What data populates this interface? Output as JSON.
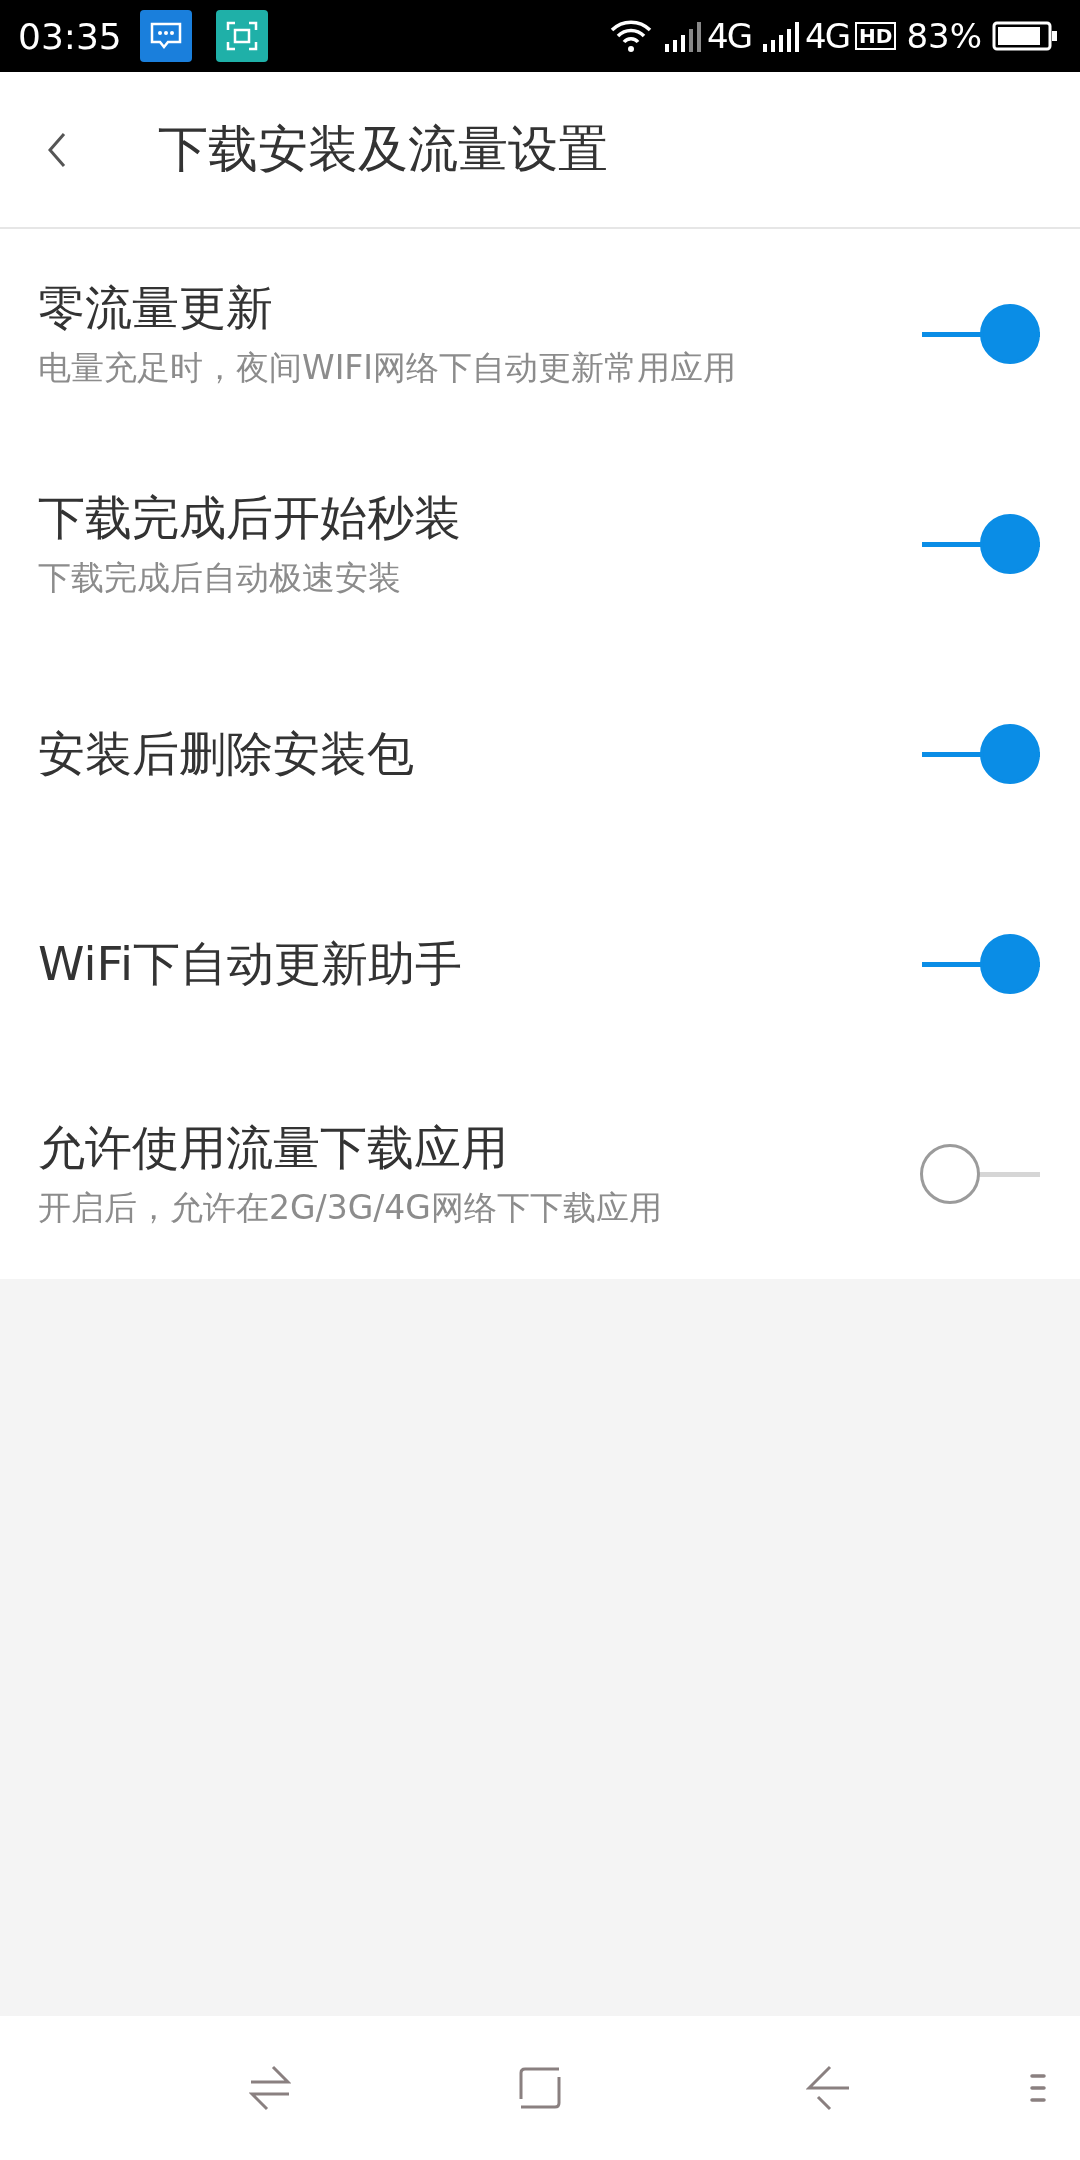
{
  "status_bar": {
    "time": "03:35",
    "network_1": "4G",
    "network_2": "4G",
    "hd": "HD",
    "battery": "83%"
  },
  "header": {
    "title": "下载安装及流量设置"
  },
  "settings": [
    {
      "title": "零流量更新",
      "subtitle": "电量充足时，夜间WIFI网络下自动更新常用应用",
      "on": true
    },
    {
      "title": "下载完成后开始秒装",
      "subtitle": "下载完成后自动极速安装",
      "on": true
    },
    {
      "title": "安装后删除安装包",
      "on": true
    },
    {
      "title": "WiFi下自动更新助手",
      "on": true
    },
    {
      "title": "允许使用流量下载应用",
      "subtitle": "开启后，允许在2G/3G/4G网络下下载应用",
      "on": false
    }
  ]
}
